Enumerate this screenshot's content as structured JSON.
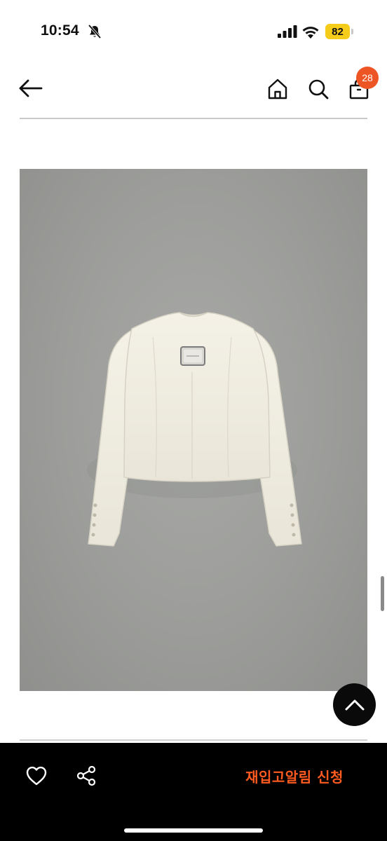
{
  "status_bar": {
    "time": "10:54",
    "battery_level": "82",
    "battery_color": "#f6cc1b",
    "icons": [
      "bell-off-icon",
      "signal-icon",
      "wifi-icon",
      "battery-icon"
    ]
  },
  "top_nav": {
    "icons": [
      "back-arrow-icon",
      "home-icon",
      "search-icon",
      "shopping-bag-icon"
    ],
    "bag_badge_count": "28",
    "badge_color": "#ee5524"
  },
  "product": {
    "image_alt": "cream cropped jacket back view on gray background"
  },
  "scroll_top_icon": "chevron-up-icon",
  "bottom_bar": {
    "icons": [
      "heart-icon",
      "share-icon"
    ],
    "restock_label": "재입고알림 신청",
    "accent_color": "#ff5a1f"
  }
}
